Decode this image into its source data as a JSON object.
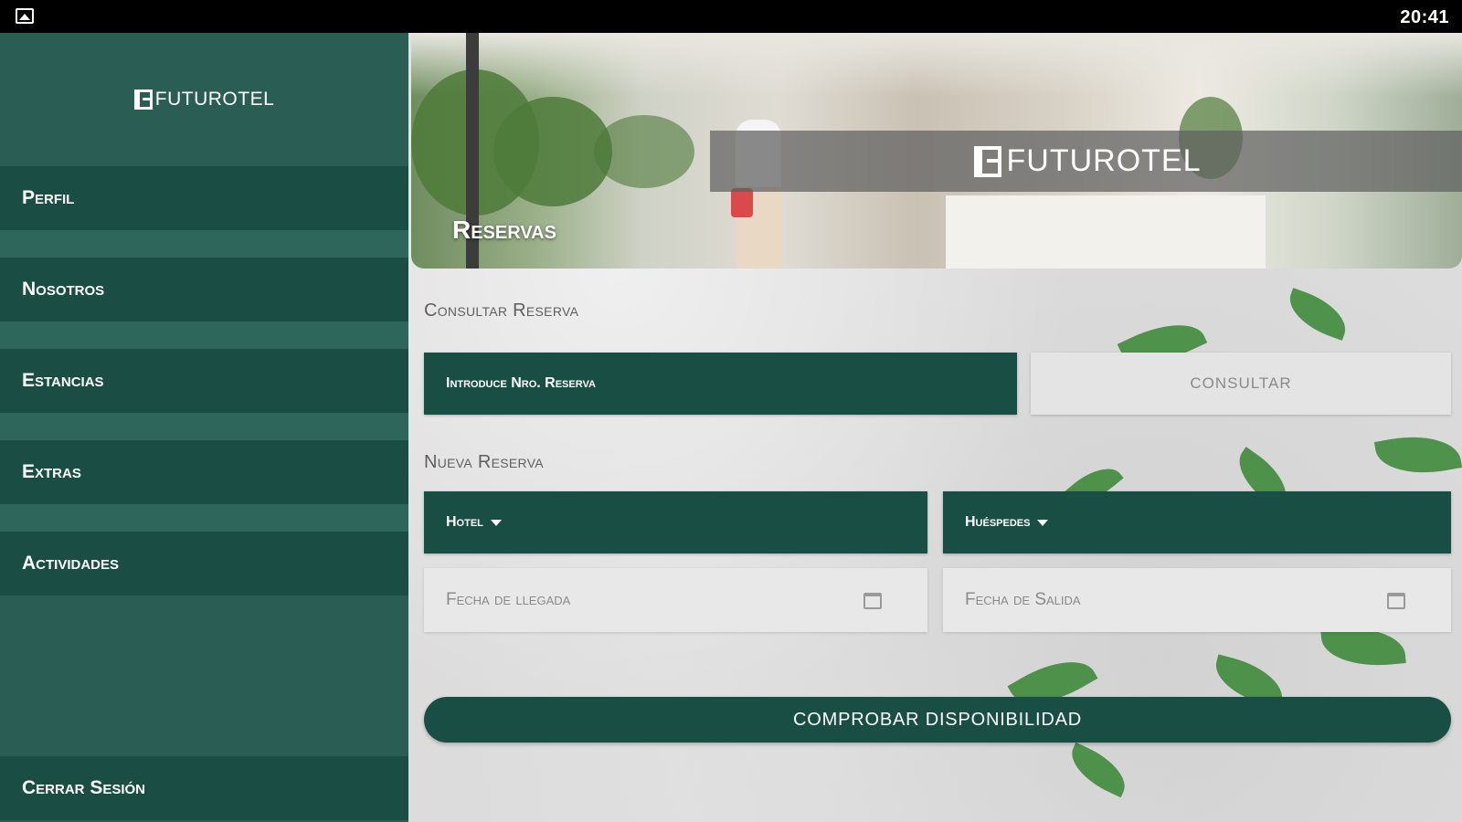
{
  "status_bar": {
    "time": "20:41",
    "notification_icon": "image-icon"
  },
  "sidebar": {
    "brand": "FUTUROTEL",
    "items": [
      {
        "label": "Perfil"
      },
      {
        "label": "Nosotros"
      },
      {
        "label": "Estancias"
      },
      {
        "label": "Extras"
      },
      {
        "label": "Actividades"
      }
    ],
    "logout_label": "Cerrar Sesión"
  },
  "hero": {
    "brand": "FUTUROTEL",
    "title": "Reservas"
  },
  "consult": {
    "section_label": "Consultar Reserva",
    "input_placeholder": "Introduce Nro. Reserva",
    "button_label": "CONSULTAR"
  },
  "new_booking": {
    "section_label": "Nueva Reserva",
    "hotel_select": "Hotel",
    "guests_select": "Huéspedes",
    "arrival_placeholder": "Fecha de llegada",
    "departure_placeholder": "Fecha de Salida",
    "submit_label": "COMPROBAR DISPONIBILIDAD"
  },
  "colors": {
    "sidebar_bg": "#2a5e55",
    "nav_item_bg": "#1a4e45",
    "primary": "#194e45",
    "field_light": "#e8e8e8"
  }
}
